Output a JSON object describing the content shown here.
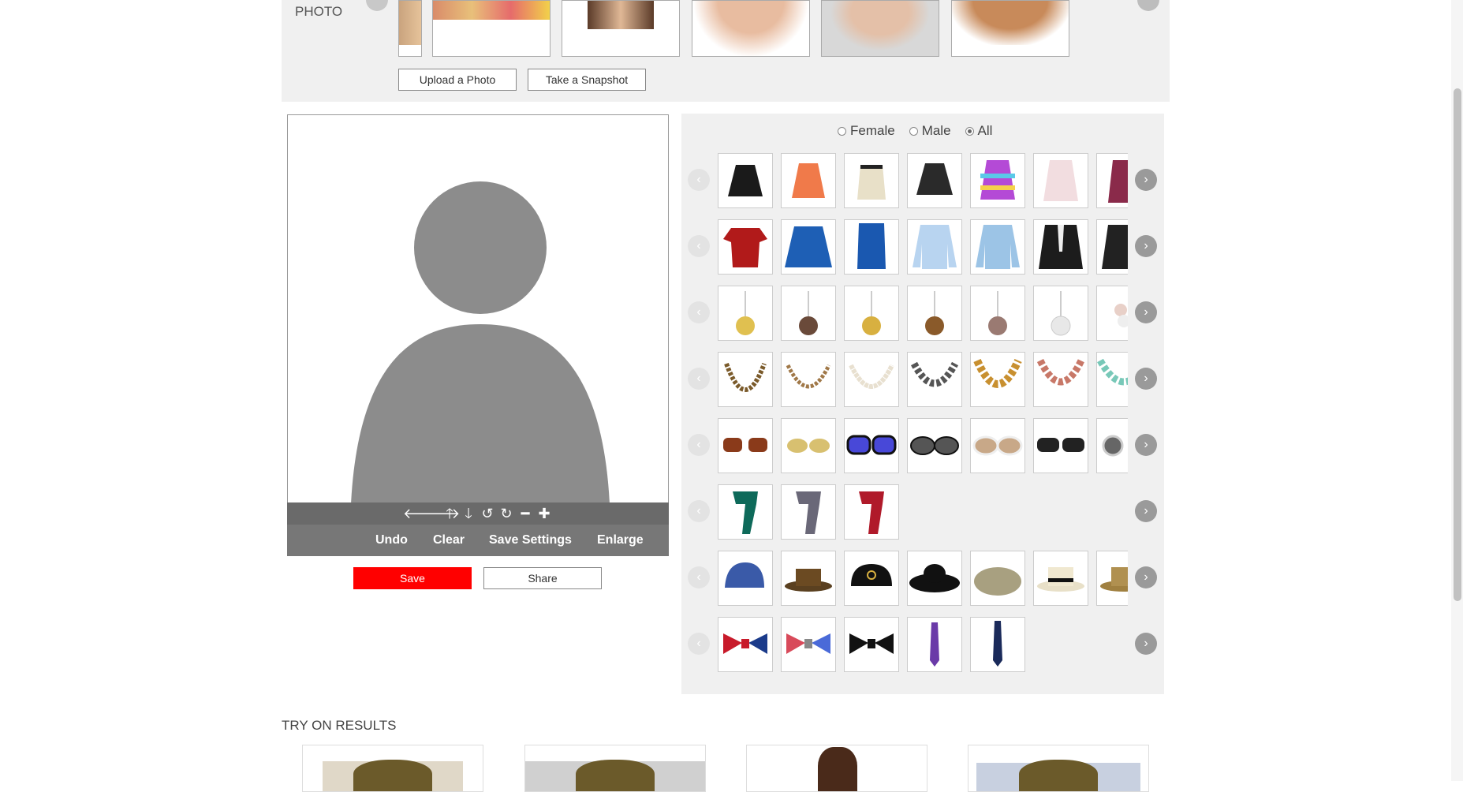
{
  "header": {
    "photo_label": "PHOTO",
    "upload_label": "Upload a Photo",
    "snapshot_label": "Take a Snapshot"
  },
  "controls": {
    "arrows": [
      "🡐",
      "🡒",
      "🡑",
      "🡓",
      "↺",
      "↻",
      "━",
      "✚"
    ],
    "undo": "Undo",
    "clear": "Clear",
    "save_settings": "Save Settings",
    "enlarge": "Enlarge",
    "save": "Save",
    "share": "Share"
  },
  "filter": {
    "options": [
      "Female",
      "Male",
      "All"
    ],
    "selected": "All"
  },
  "catalog": {
    "rows": [
      {
        "category": "skirts",
        "count": 7
      },
      {
        "category": "shirts",
        "count": 7
      },
      {
        "category": "earrings",
        "count": 7
      },
      {
        "category": "necklaces",
        "count": 7
      },
      {
        "category": "sunglasses",
        "count": 7
      },
      {
        "category": "scarves",
        "count": 3
      },
      {
        "category": "hats",
        "count": 7
      },
      {
        "category": "ties",
        "count": 5
      }
    ]
  },
  "results": {
    "title": "TRY ON RESULTS"
  },
  "colors": {
    "save_button": "#ff0000",
    "toolbar": "#6a6a6a",
    "panel_bg": "#f0f0f0"
  }
}
